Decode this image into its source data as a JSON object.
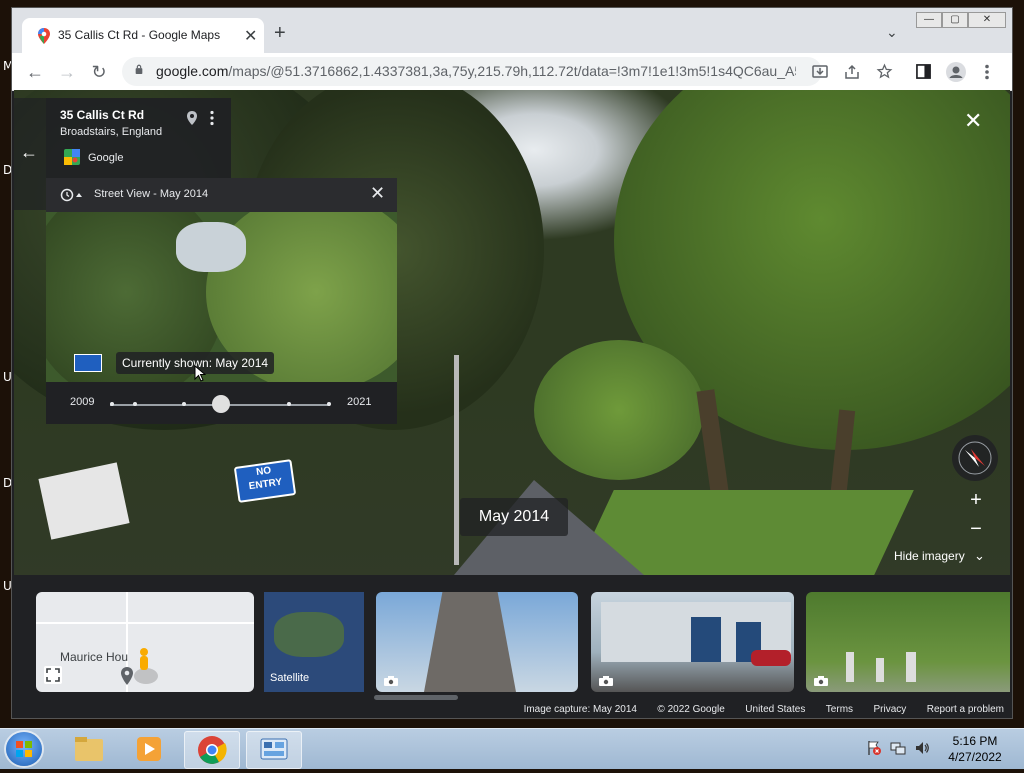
{
  "desktop": {
    "side_letters": [
      "M",
      "D",
      "U",
      "D",
      "U"
    ]
  },
  "browser": {
    "tab": {
      "title": "35 Callis Ct Rd - Google Maps",
      "close_glyph": "✕"
    },
    "new_tab_glyph": "+",
    "tab_menu_glyph": "⌄",
    "window_controls": {
      "minimize": "—",
      "maximize": "▢",
      "close": "✕"
    },
    "nav": {
      "back": "←",
      "forward": "→",
      "reload": "↻"
    },
    "address": {
      "host": "google.com",
      "path": "/maps/@51.3716862,1.4337381,3a,75y,215.79h,112.72t/data=!3m7!1e1!3m5!1s4QC6au_A5..."
    },
    "toolbar_icons": [
      "install-icon",
      "share-icon",
      "bookmark-star-icon",
      "side-panel-icon",
      "profile-icon",
      "menu-icon"
    ]
  },
  "maps": {
    "place": {
      "name": "35 Callis Ct Rd",
      "location": "Broadstairs, England",
      "provider": "Google"
    },
    "back_glyph": "←",
    "timeline": {
      "header": "Street View - May 2014",
      "tooltip": "Currently shown: May 2014",
      "start_year": "2009",
      "end_year": "2021",
      "selected_fraction": 0.5
    },
    "current_date": "May 2014",
    "hide_imagery": "Hide imagery",
    "zoom": {
      "in": "+",
      "out": "−"
    },
    "close_glyph": "✕",
    "signs": {
      "no_entry_line1": "NO",
      "no_entry_line2": "ENTRY"
    },
    "thumbnails": {
      "map_label": "Maurice Hou",
      "satellite_label": "Satellite"
    },
    "footer": [
      "Image capture: May 2014",
      "© 2022 Google",
      "United States",
      "Terms",
      "Privacy",
      "Report a problem"
    ]
  },
  "taskbar": {
    "clock_time": "5:16 PM",
    "clock_date": "4/27/2022"
  },
  "colors": {
    "chrome_tab_strip": "#dee1e6",
    "maps_panel": "#202124",
    "taskbar": "#b9cde2"
  }
}
